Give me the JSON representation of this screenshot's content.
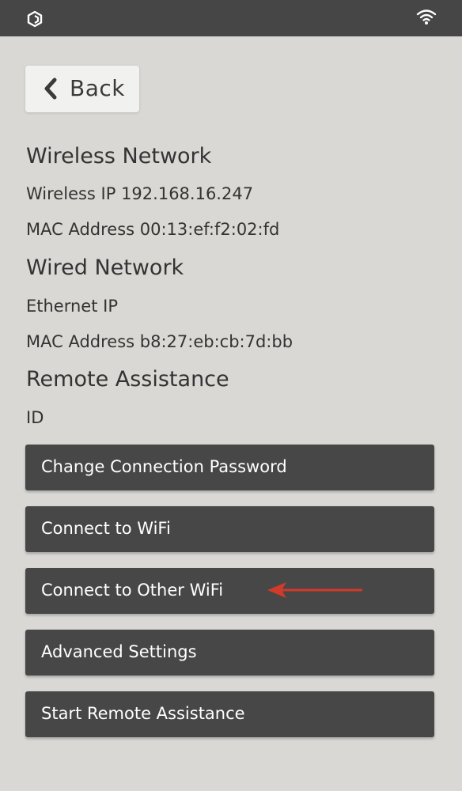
{
  "nav": {
    "back_label": "Back"
  },
  "wireless": {
    "title": "Wireless Network",
    "ip_line": "Wireless IP 192.168.16.247",
    "mac_line": "MAC Address 00:13:ef:f2:02:fd"
  },
  "wired": {
    "title": "Wired Network",
    "ip_line": "Ethernet IP",
    "mac_line": "MAC Address b8:27:eb:cb:7d:bb"
  },
  "remote": {
    "title": "Remote Assistance",
    "id_line": "ID"
  },
  "actions": [
    {
      "label": "Change Connection Password"
    },
    {
      "label": "Connect to WiFi"
    },
    {
      "label": "Connect to Other WiFi"
    },
    {
      "label": "Advanced Settings"
    },
    {
      "label": "Start Remote Assistance"
    }
  ],
  "icons": {
    "app_logo": "app-logo-icon",
    "wifi_status": "wifi-icon",
    "back": "chevron-left-icon",
    "annotation": "arrow-left-icon"
  },
  "colors": {
    "background": "#d9d8d5",
    "topbar": "#464646",
    "button_dark": "#474747",
    "button_light": "#f1f1f0",
    "annotation_arrow": "#d23a2a"
  }
}
